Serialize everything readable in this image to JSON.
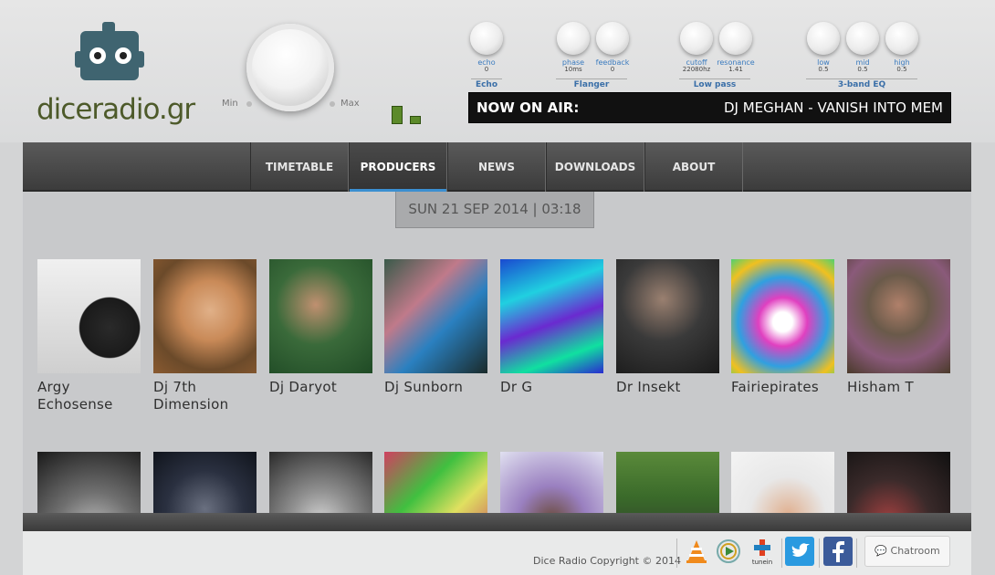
{
  "logo": {
    "text": "diceradio.gr",
    "icon": "robot-logo-icon"
  },
  "volume": {
    "min_label": "Min",
    "max_label": "Max"
  },
  "effects": {
    "echo": {
      "name": "Echo",
      "knobs": [
        {
          "label": "echo",
          "value": "0"
        }
      ]
    },
    "flanger": {
      "name": "Flanger",
      "knobs": [
        {
          "label": "phase",
          "value": "10ms"
        },
        {
          "label": "feedback",
          "value": "0"
        }
      ]
    },
    "lowpass": {
      "name": "Low pass",
      "knobs": [
        {
          "label": "cutoff",
          "value": "22080hz"
        },
        {
          "label": "resonance",
          "value": "1.41"
        }
      ]
    },
    "eq": {
      "name": "3-band EQ",
      "knobs": [
        {
          "label": "low",
          "value": "0.5"
        },
        {
          "label": "mid",
          "value": "0.5"
        },
        {
          "label": "high",
          "value": "0.5"
        }
      ]
    }
  },
  "now_on_air": {
    "label": "NOW ON AIR:",
    "track": "DJ MEGHAN - VANISH INTO MEM"
  },
  "nav": {
    "items": [
      {
        "label": "TIMETABLE"
      },
      {
        "label": "PRODUCERS"
      },
      {
        "label": "NEWS"
      },
      {
        "label": "DOWNLOADS"
      },
      {
        "label": "ABOUT"
      }
    ],
    "active": "PRODUCERS"
  },
  "datebar": {
    "text": "SUN 21 SEP 2014 | 03:18"
  },
  "producers": [
    {
      "name": "Argy Echosense"
    },
    {
      "name": "Dj 7th Dimension"
    },
    {
      "name": "Dj Daryot"
    },
    {
      "name": "Dj Sunborn"
    },
    {
      "name": "Dr G"
    },
    {
      "name": "Dr Insekt"
    },
    {
      "name": "Fairiepirates"
    },
    {
      "name": "Hisham T"
    }
  ],
  "footer": {
    "copyright": "Dice Radio Copyright © 2014",
    "icons": [
      "vlc-icon",
      "media-player-icon",
      "tunein-icon",
      "twitter-icon",
      "facebook-icon"
    ],
    "chat_label": "Chatroom"
  },
  "colors": {
    "accent": "#3b8fd1",
    "logo": "#4d5a2a",
    "robot": "#3f6470",
    "nav": "#4a4a4a"
  }
}
